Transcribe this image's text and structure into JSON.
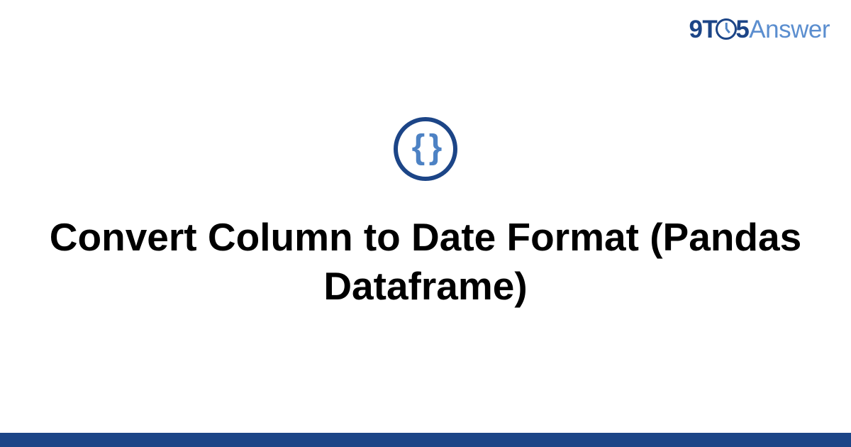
{
  "logo": {
    "nine": "9",
    "t": "T",
    "five": "5",
    "answer": "Answer"
  },
  "icon": {
    "braces": "{ }"
  },
  "title": "Convert Column to Date Format (Pandas Dataframe)"
}
